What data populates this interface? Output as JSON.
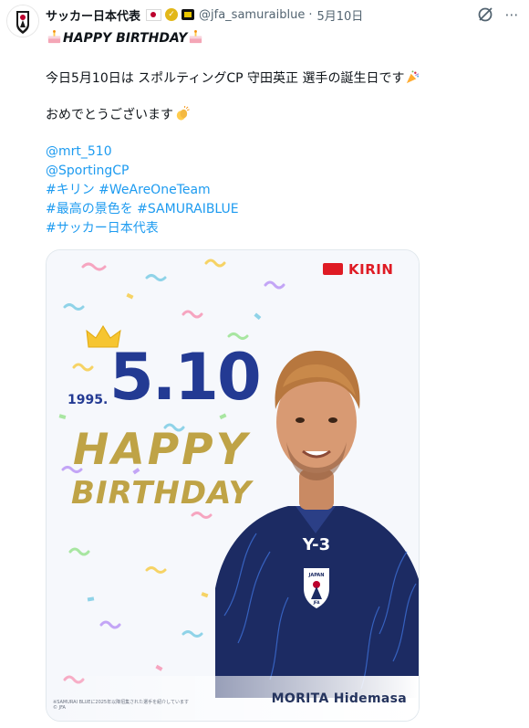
{
  "account": {
    "display_name": "サッカー日本代表",
    "handle": "@jfa_samuraiblue",
    "separator": "·",
    "date": "5月10日",
    "icons": [
      "japan-flag",
      "verified-gold-badge",
      "affiliation-badge"
    ]
  },
  "tweet": {
    "headline": "HAPPY BIRTHDAY",
    "line1": "今日5月10日は スポルティングCP 守田英正 選手の誕生日です",
    "line2": "おめでとうございます",
    "mentions": [
      "@mrt_510",
      "@SportingCP"
    ],
    "hashtags1": "#キリン #WeAreOneTeam",
    "hashtags2": "#最高の景色を #SAMURAIBLUE",
    "hashtags3": "#サッカー日本代表"
  },
  "image": {
    "sponsor": "KIRIN",
    "year": "1995.",
    "date": "5.10",
    "happy": "HAPPY",
    "birthday": "BIRTHDAY",
    "player_name": "MORITA Hidemasa",
    "jersey_text": "Y-3",
    "crest_text": "JAPAN",
    "crest_sub": "JFA",
    "footnote1": "※SAMURAI BLUEに2025年以降招集された選手を紹介しています",
    "footnote2": "© JFA"
  },
  "colors": {
    "link": "#1d9bf0",
    "date_blue": "#233a93",
    "gold": "#bfa346",
    "kirin_red": "#df1b24",
    "jersey_navy": "#1c2b63"
  }
}
